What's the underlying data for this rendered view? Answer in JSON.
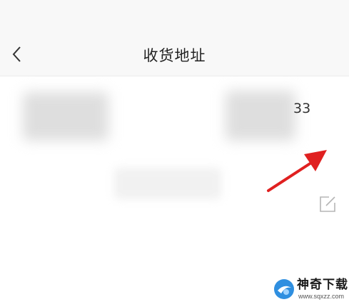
{
  "header": {
    "title": "收货地址",
    "back_icon": "chevron-left-icon"
  },
  "address": {
    "phone_visible_tail": "33",
    "edit_icon": "edit-icon"
  },
  "annotation": {
    "arrow_icon": "red-arrow-icon",
    "color": "#e02020"
  },
  "watermark": {
    "title": "神奇下载",
    "url": "www.sqxzz.com"
  }
}
